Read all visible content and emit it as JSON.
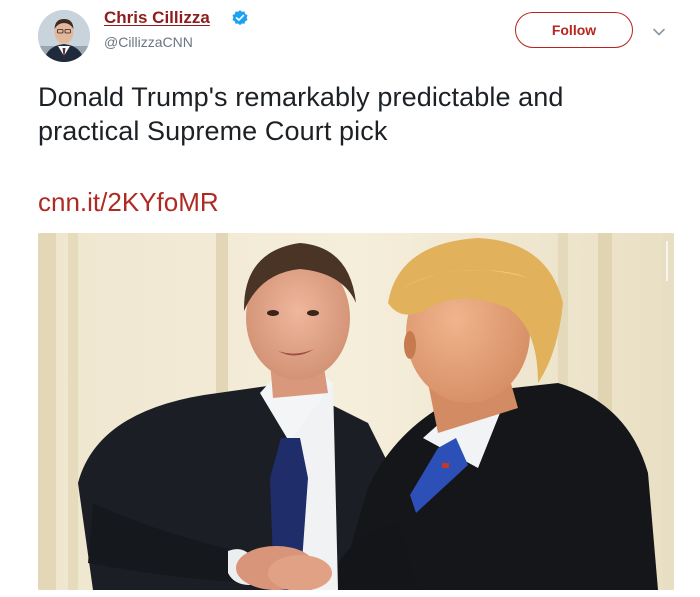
{
  "author": {
    "name": "Chris Cillizza",
    "handle": "@CillizzaCNN",
    "avatar_icon": "person-avatar"
  },
  "follow_button": {
    "label": "Follow"
  },
  "tweet": {
    "text": "Donald Trump's remarkably predictable and practical Supreme Court pick",
    "link": "cnn.it/2KYfoMR"
  },
  "colors": {
    "name_link": "#8f1d1d",
    "follow_accent": "#b8241f",
    "link_text": "#b02a24",
    "verified_badge": "#1da1f2",
    "body_text": "#1c2126",
    "handle_text": "#6b7680"
  },
  "icons": {
    "verified": "verified-badge-icon",
    "more": "chevron-down-icon"
  }
}
